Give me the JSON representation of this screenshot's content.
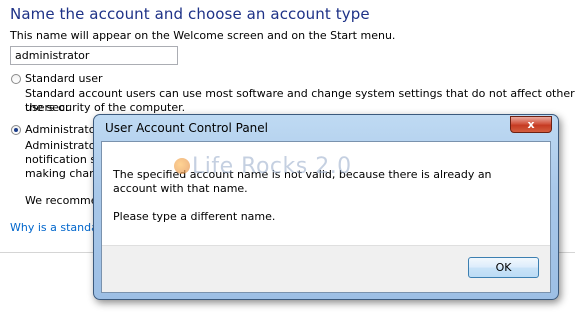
{
  "page": {
    "heading": "Name the account and choose an account type",
    "subtitle": "This name will appear on the Welcome screen and on the Start menu.",
    "name_input_value": "administrator",
    "options": [
      {
        "label": "Standard user",
        "desc_line1": "Standard account users can use most software and change system settings that do not affect other users or",
        "desc_line2": "the security of the computer.",
        "selected": false
      },
      {
        "label": "Administrator",
        "desc_line1": "Administrator",
        "desc_line2": "notification se",
        "desc_line3": "making chang",
        "selected": true
      }
    ],
    "recommend_text": "We recomme",
    "link_text": "Why is a standard"
  },
  "dialog": {
    "title": "User Account Control Panel",
    "close_label": "x",
    "message": "The specified account name is not valid, because there is already an account with that name.",
    "prompt": "Please type a different name.",
    "ok_label": "OK",
    "watermark": "Life Rocks 2.0"
  },
  "colors": {
    "heading": "#1e3287",
    "link": "#0066cc",
    "close_button": "#c53b23"
  },
  "icons": {
    "radio": "radio-button-icon",
    "watermark": "globe-icon"
  }
}
